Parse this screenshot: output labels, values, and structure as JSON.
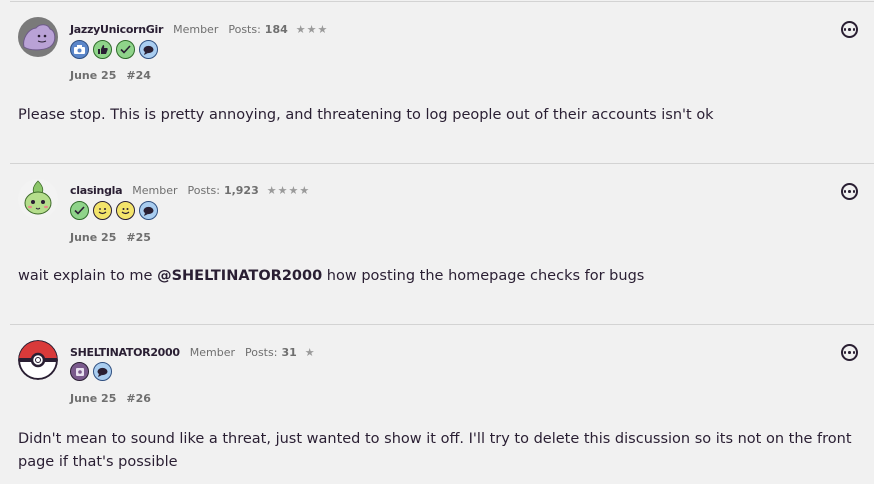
{
  "posts": [
    {
      "author": "JazzyUnicornGir",
      "role": "Member",
      "posts_label": "Posts:",
      "posts_count": "184",
      "stars": "★★★",
      "date": "June 25",
      "number": "#24",
      "text": "Please stop. This is pretty annoying, and threatening to log people out of their accounts isn't ok",
      "badges": [
        "camera-badge",
        "thumbs-up-badge",
        "check-badge",
        "comment-badge"
      ]
    },
    {
      "author": "clasingla",
      "role": "Member",
      "posts_label": "Posts:",
      "posts_count": "1,923",
      "stars": "★★★★",
      "date": "June 25",
      "number": "#25",
      "text_before": "wait explain to me ",
      "mention": "@SHELTINATOR2000",
      "text_after": " how posting the homepage checks for bugs",
      "badges": [
        "check-badge",
        "wink-badge",
        "smile-badge",
        "comment-badge"
      ]
    },
    {
      "author": "SHELTINATOR2000",
      "role": "Member",
      "posts_label": "Posts:",
      "posts_count": "31",
      "stars": "★",
      "date": "June 25",
      "number": "#26",
      "text": "Didn't mean to sound like a threat, just wanted to show it off. I'll try to delete this discussion so its not on the front page if that's possible",
      "badges": [
        "first-post-badge",
        "comment-badge"
      ]
    }
  ],
  "colors": {
    "background": "#f1f1f1",
    "text": "#2a1f33",
    "muted": "#6f6f6f",
    "badge_blue": "#5b86c9",
    "badge_green": "#8fd48a",
    "badge_yellow": "#f3e46b",
    "badge_purple": "#7a5a8c"
  }
}
